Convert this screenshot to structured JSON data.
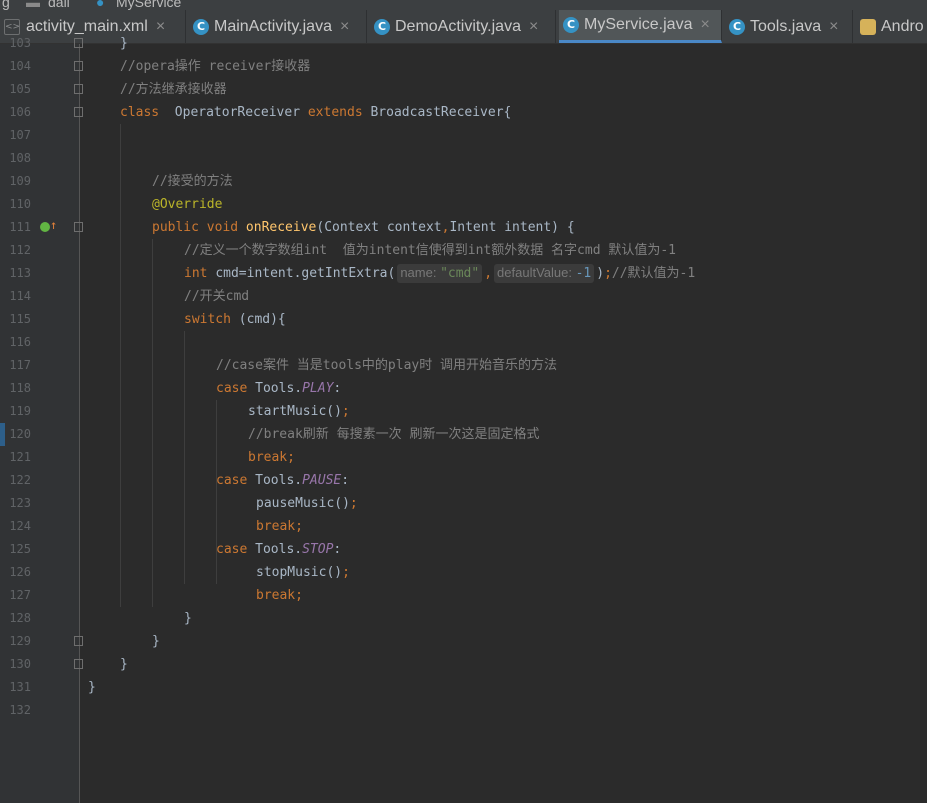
{
  "breadcrumb": {
    "items": [
      "g",
      "dali",
      "MyService"
    ]
  },
  "tabs": [
    {
      "label": "activity_main.xml",
      "icon": "xml-file-icon",
      "closable": true
    },
    {
      "label": "MainActivity.java",
      "icon": "class-icon",
      "closable": true
    },
    {
      "label": "DemoActivity.java",
      "icon": "class-icon",
      "closable": true
    },
    {
      "label": "MyService.java",
      "icon": "class-icon",
      "closable": true,
      "active": true
    },
    {
      "label": "Tools.java",
      "icon": "class-icon",
      "closable": true
    },
    {
      "label": "Andro",
      "icon": "android-icon",
      "closable": false
    }
  ],
  "editor": {
    "lines": [
      {
        "n": "103",
        "indent": 1,
        "tokens": [
          {
            "t": "}",
            "c": ""
          }
        ]
      },
      {
        "n": "104",
        "indent": 1,
        "tokens": [
          {
            "t": "//opera操作 receiver接收器",
            "c": "cm"
          }
        ]
      },
      {
        "n": "105",
        "indent": 1,
        "tokens": [
          {
            "t": "//方法继承接收器",
            "c": "cm"
          }
        ]
      },
      {
        "n": "106",
        "indent": 1,
        "tokens": [
          {
            "t": "class",
            "c": "kw"
          },
          {
            "t": "  OperatorReceiver ",
            "c": ""
          },
          {
            "t": "extends",
            "c": "kw"
          },
          {
            "t": " BroadcastReceiver{",
            "c": ""
          }
        ]
      },
      {
        "n": "107",
        "indent": 0,
        "tokens": []
      },
      {
        "n": "108",
        "indent": 0,
        "tokens": []
      },
      {
        "n": "109",
        "indent": 2,
        "tokens": [
          {
            "t": "//接受的方法",
            "c": "cm"
          }
        ]
      },
      {
        "n": "110",
        "indent": 2,
        "tokens": [
          {
            "t": "@Override",
            "c": "an"
          }
        ]
      },
      {
        "n": "111",
        "indent": 2,
        "tokens": [
          {
            "t": "public void ",
            "c": "kw"
          },
          {
            "t": "onReceive",
            "c": "fn"
          },
          {
            "t": "(Context context",
            "c": ""
          },
          {
            "t": ",",
            "c": "kw"
          },
          {
            "t": "Intent intent) {",
            "c": ""
          }
        ]
      },
      {
        "n": "112",
        "indent": 3,
        "tokens": [
          {
            "t": "//定义一个数字数组int  值为intent信使得到int额外数据 名字cmd 默认值为-1",
            "c": "cm"
          }
        ]
      },
      {
        "n": "113",
        "indent": 3,
        "tokens": [
          {
            "t": "int ",
            "c": "kw"
          },
          {
            "t": "cmd=intent.getIntExtra(",
            "c": ""
          },
          {
            "hint": "name:",
            "hv": "\"cmd\"",
            "hc": "str"
          },
          {
            "t": ",",
            "c": "kw"
          },
          {
            "hint": "defaultValue:",
            "hv": "-1",
            "hc": "num-lit"
          },
          {
            "t": ")",
            "c": ""
          },
          {
            "t": ";",
            "c": "kw"
          },
          {
            "t": "//默认值为-1",
            "c": "cm"
          }
        ]
      },
      {
        "n": "114",
        "indent": 3,
        "tokens": [
          {
            "t": "//开关cmd",
            "c": "cm"
          }
        ]
      },
      {
        "n": "115",
        "indent": 3,
        "tokens": [
          {
            "t": "switch ",
            "c": "kw"
          },
          {
            "t": "(cmd){",
            "c": ""
          }
        ]
      },
      {
        "n": "116",
        "indent": 0,
        "tokens": []
      },
      {
        "n": "117",
        "indent": 4,
        "tokens": [
          {
            "t": "//case案件 当是tools中的play时 调用开始音乐的方法",
            "c": "cm"
          }
        ]
      },
      {
        "n": "118",
        "indent": 4,
        "tokens": [
          {
            "t": "case ",
            "c": "kw"
          },
          {
            "t": "Tools.",
            "c": ""
          },
          {
            "t": "PLAY",
            "c": "it"
          },
          {
            "t": ":",
            "c": ""
          }
        ]
      },
      {
        "n": "119",
        "indent": 5,
        "tokens": [
          {
            "t": "startMusic()",
            "c": ""
          },
          {
            "t": ";",
            "c": "kw"
          }
        ]
      },
      {
        "n": "120",
        "indent": 5,
        "tokens": [
          {
            "t": "//break刷新 每搜素一次 刷新一次这是固定格式",
            "c": "cm"
          }
        ]
      },
      {
        "n": "121",
        "indent": 5,
        "tokens": [
          {
            "t": "break;",
            "c": "kw"
          }
        ]
      },
      {
        "n": "122",
        "indent": 4,
        "tokens": [
          {
            "t": "case ",
            "c": "kw"
          },
          {
            "t": "Tools.",
            "c": ""
          },
          {
            "t": "PAUSE",
            "c": "it"
          },
          {
            "t": ":",
            "c": ""
          }
        ]
      },
      {
        "n": "123",
        "indent": 5.25,
        "tokens": [
          {
            "t": "pauseMusic()",
            "c": ""
          },
          {
            "t": ";",
            "c": "kw"
          }
        ]
      },
      {
        "n": "124",
        "indent": 5.25,
        "tokens": [
          {
            "t": "break;",
            "c": "kw"
          }
        ]
      },
      {
        "n": "125",
        "indent": 4,
        "tokens": [
          {
            "t": "case ",
            "c": "kw"
          },
          {
            "t": "Tools.",
            "c": ""
          },
          {
            "t": "STOP",
            "c": "it"
          },
          {
            "t": ":",
            "c": ""
          }
        ]
      },
      {
        "n": "126",
        "indent": 5.25,
        "tokens": [
          {
            "t": "stopMusic()",
            "c": ""
          },
          {
            "t": ";",
            "c": "kw"
          }
        ]
      },
      {
        "n": "127",
        "indent": 5.25,
        "tokens": [
          {
            "t": "break;",
            "c": "kw"
          }
        ]
      },
      {
        "n": "128",
        "indent": 3,
        "tokens": [
          {
            "t": "}",
            "c": ""
          }
        ]
      },
      {
        "n": "129",
        "indent": 2,
        "tokens": [
          {
            "t": "}",
            "c": ""
          }
        ]
      },
      {
        "n": "130",
        "indent": 1,
        "tokens": [
          {
            "t": "}",
            "c": ""
          }
        ]
      },
      {
        "n": "131",
        "indent": 0,
        "tokens": [
          {
            "t": "}",
            "c": ""
          }
        ]
      },
      {
        "n": "132",
        "indent": 0,
        "tokens": []
      }
    ]
  },
  "gutter_markers": {
    "override_line": "111",
    "override_icon": "implements-method-icon",
    "fold_lines": [
      "103",
      "104",
      "105",
      "106",
      "111",
      "129",
      "130"
    ]
  },
  "colors": {
    "keyword": "#cc7832",
    "comment": "#808080",
    "annotation": "#bbb529",
    "method": "#ffc66d",
    "constant": "#9876aa",
    "number": "#6897bb",
    "string": "#6a8759",
    "text": "#a9b7c6",
    "background": "#2b2b2b"
  }
}
